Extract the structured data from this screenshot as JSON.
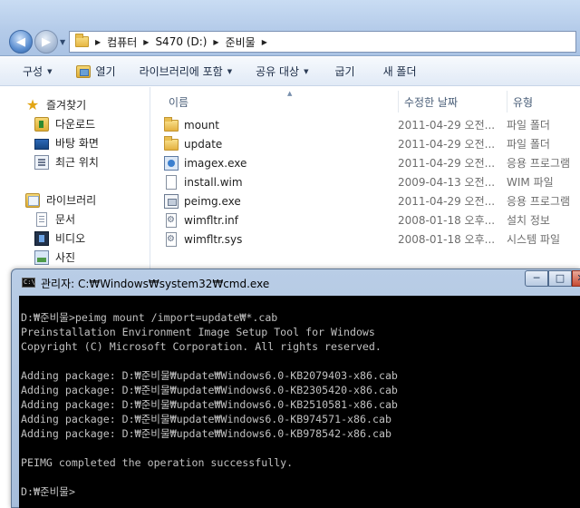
{
  "explorer": {
    "breadcrumb": [
      "컴퓨터",
      "S470 (D:)",
      "준비물"
    ],
    "toolbar": {
      "organize": "구성",
      "open": "열기",
      "include_library": "라이브러리에 포함",
      "share": "공유 대상",
      "burn": "굽기",
      "new_folder": "새 폴더"
    },
    "nav": {
      "favorites": "즐겨찾기",
      "downloads": "다운로드",
      "desktop": "바탕 화면",
      "recent": "최근 위치",
      "libraries": "라이브러리",
      "documents": "문서",
      "videos": "비디오",
      "pictures": "사진"
    },
    "columns": {
      "name": "이름",
      "date": "수정한 날짜",
      "type": "유형"
    },
    "files": [
      {
        "name": "mount",
        "date": "2011-04-29 오전...",
        "type": "파일 폴더",
        "icon": "folder-icon"
      },
      {
        "name": "update",
        "date": "2011-04-29 오전...",
        "type": "파일 폴더",
        "icon": "folder-icon"
      },
      {
        "name": "imagex.exe",
        "date": "2011-04-29 오전...",
        "type": "응용 프로그램",
        "icon": "exe-icon"
      },
      {
        "name": "install.wim",
        "date": "2009-04-13 오전...",
        "type": "WIM 파일",
        "icon": "file-icon"
      },
      {
        "name": "peimg.exe",
        "date": "2011-04-29 오전...",
        "type": "응용 프로그램",
        "icon": "exe-icon"
      },
      {
        "name": "wimfltr.inf",
        "date": "2008-01-18 오후...",
        "type": "설치 정보",
        "icon": "settings-file-icon"
      },
      {
        "name": "wimfltr.sys",
        "date": "2008-01-18 오후...",
        "type": "시스템 파일",
        "icon": "system-file-icon"
      }
    ]
  },
  "cmd": {
    "icon_text": "C:\\",
    "title": "관리자: C:₩Windows₩system32₩cmd.exe",
    "buttons": {
      "minimize": "─",
      "maximize": "□",
      "close": "✕"
    },
    "lines": [
      "",
      "D:₩준비물>peimg mount /import=update₩*.cab",
      "Preinstallation Environment Image Setup Tool for Windows",
      "Copyright (C) Microsoft Corporation. All rights reserved.",
      "",
      "Adding package: D:₩준비물₩update₩Windows6.0-KB2079403-x86.cab",
      "Adding package: D:₩준비물₩update₩Windows6.0-KB2305420-x86.cab",
      "Adding package: D:₩준비물₩update₩Windows6.0-KB2510581-x86.cab",
      "Adding package: D:₩준비물₩update₩Windows6.0-KB974571-x86.cab",
      "Adding package: D:₩준비물₩update₩Windows6.0-KB978542-x86.cab",
      "",
      "PEIMG completed the operation successfully.",
      "",
      "D:₩준비물>"
    ]
  }
}
